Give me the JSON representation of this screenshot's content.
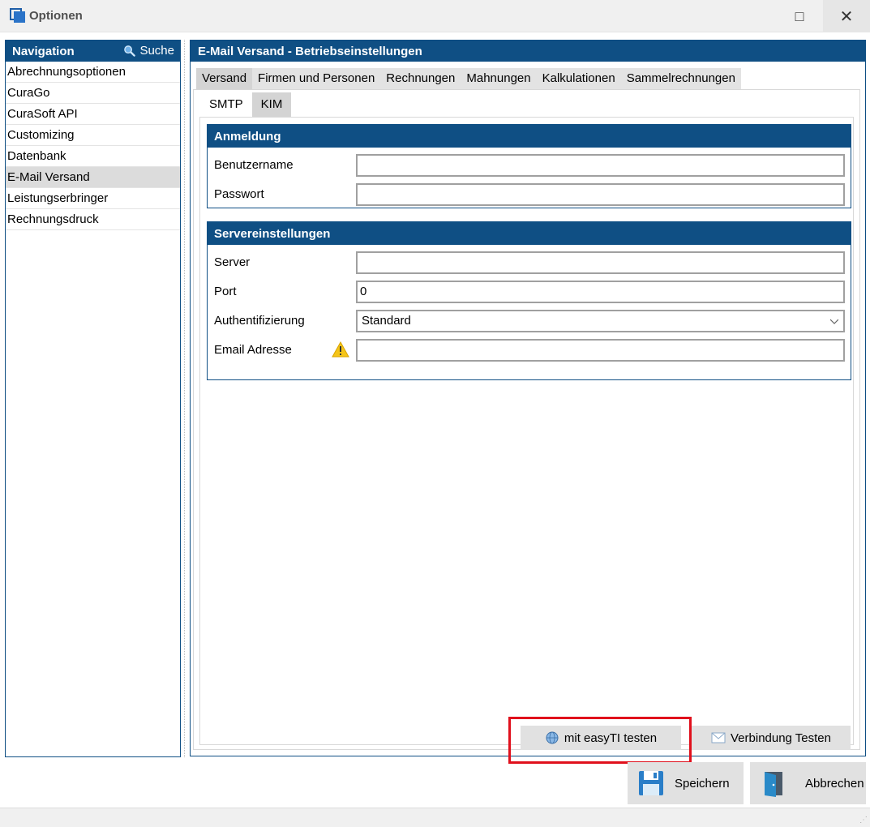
{
  "window": {
    "title": "Optionen",
    "maximize_glyph": "□",
    "close_glyph": "✕"
  },
  "navigation": {
    "title": "Navigation",
    "search_label": "Suche",
    "items": [
      {
        "label": "Abrechnungsoptionen",
        "active": false
      },
      {
        "label": "CuraGo",
        "active": false
      },
      {
        "label": "CuraSoft API",
        "active": false
      },
      {
        "label": "Customizing",
        "active": false
      },
      {
        "label": "Datenbank",
        "active": false
      },
      {
        "label": "E-Mail Versand",
        "active": true
      },
      {
        "label": "Leistungserbringer",
        "active": false
      },
      {
        "label": "Rechnungsdruck",
        "active": false
      }
    ]
  },
  "main": {
    "title": "E-Mail Versand - Betriebseinstellungen",
    "tabs": [
      {
        "label": "Versand",
        "active": true
      },
      {
        "label": "Firmen und Personen",
        "active": false
      },
      {
        "label": "Rechnungen",
        "active": false
      },
      {
        "label": "Mahnungen",
        "active": false
      },
      {
        "label": "Kalkulationen",
        "active": false
      },
      {
        "label": "Sammelrechnungen",
        "active": false
      }
    ],
    "subtabs": [
      {
        "label": "SMTP",
        "active": false
      },
      {
        "label": "KIM",
        "active": true
      }
    ],
    "anmeldung": {
      "title": "Anmeldung",
      "username_label": "Benutzername",
      "username_value": "",
      "password_label": "Passwort",
      "password_value": ""
    },
    "server": {
      "title": "Servereinstellungen",
      "server_label": "Server",
      "server_value": "",
      "port_label": "Port",
      "port_value": "0",
      "auth_label": "Authentifizierung",
      "auth_value": "Standard",
      "email_label": "Email Adresse",
      "email_value": ""
    },
    "buttons": {
      "easyti_label": "mit easyTI testen",
      "connection_label": "Verbindung Testen"
    }
  },
  "footer": {
    "save_label": "Speichern",
    "cancel_label": "Abbrechen"
  },
  "colors": {
    "header_blue": "#0f4f84",
    "highlight_red": "#e0101c"
  }
}
